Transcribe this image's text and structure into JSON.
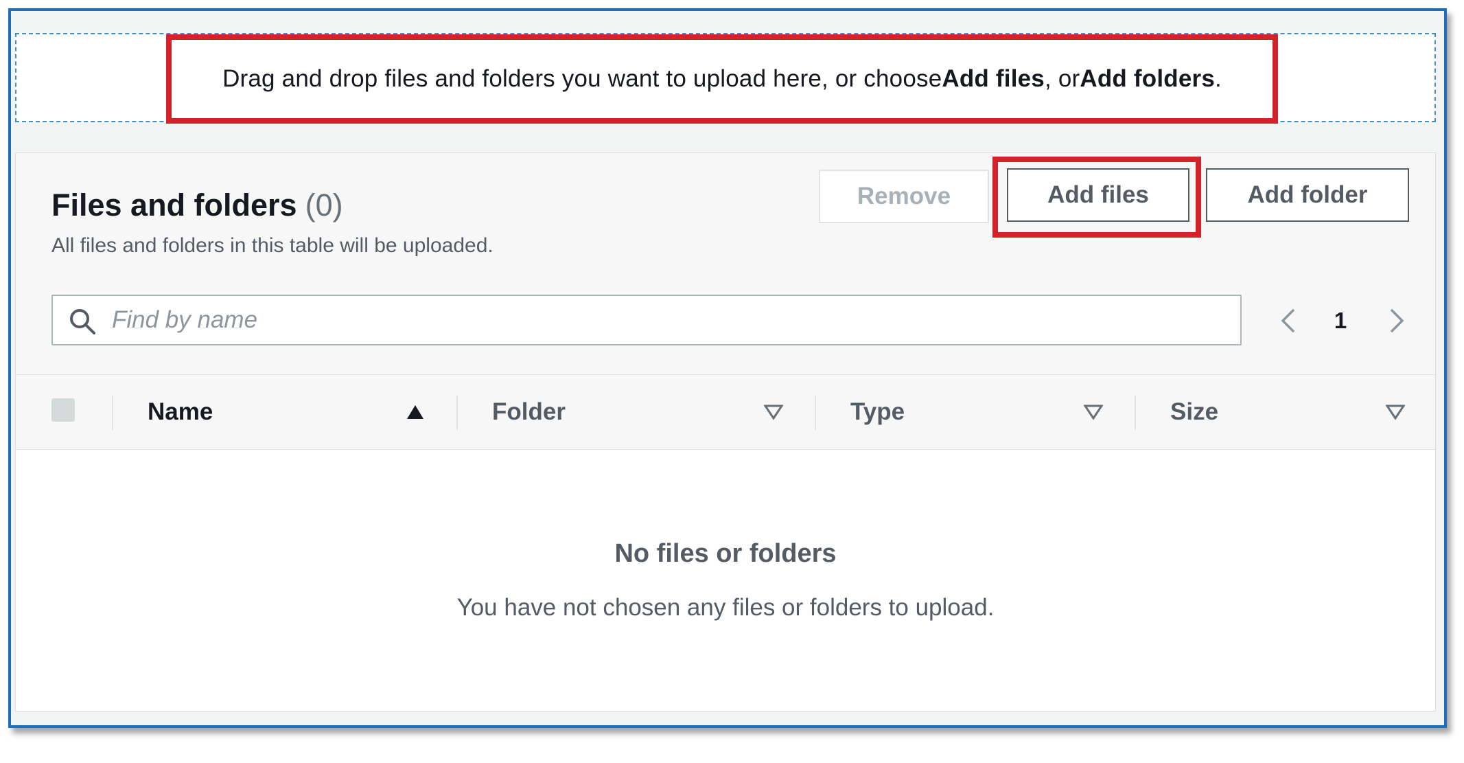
{
  "dropzone": {
    "text_prefix": "Drag and drop files and folders you want to upload here, or choose ",
    "add_files_strong": "Add files",
    "text_middle": ", or ",
    "add_folders_strong": "Add folders",
    "text_suffix": "."
  },
  "panel": {
    "title": "Files and folders",
    "count": "(0)",
    "description": "All files and folders in this table will be uploaded."
  },
  "buttons": {
    "remove": "Remove",
    "add_files": "Add files",
    "add_folder": "Add folder"
  },
  "search": {
    "placeholder": "Find by name",
    "value": ""
  },
  "pagination": {
    "current_page": "1"
  },
  "table": {
    "columns": [
      {
        "label": "Name",
        "sort": "ascending"
      },
      {
        "label": "Folder",
        "sort": "none"
      },
      {
        "label": "Type",
        "sort": "none"
      },
      {
        "label": "Size",
        "sort": "none"
      }
    ]
  },
  "empty_state": {
    "title": "No files or folders",
    "description": "You have not chosen any files or folders to upload."
  },
  "colors": {
    "highlight": "#d2232a",
    "frame_border": "#1f6fb6",
    "text_primary": "#16191f",
    "text_secondary": "#545b64"
  }
}
